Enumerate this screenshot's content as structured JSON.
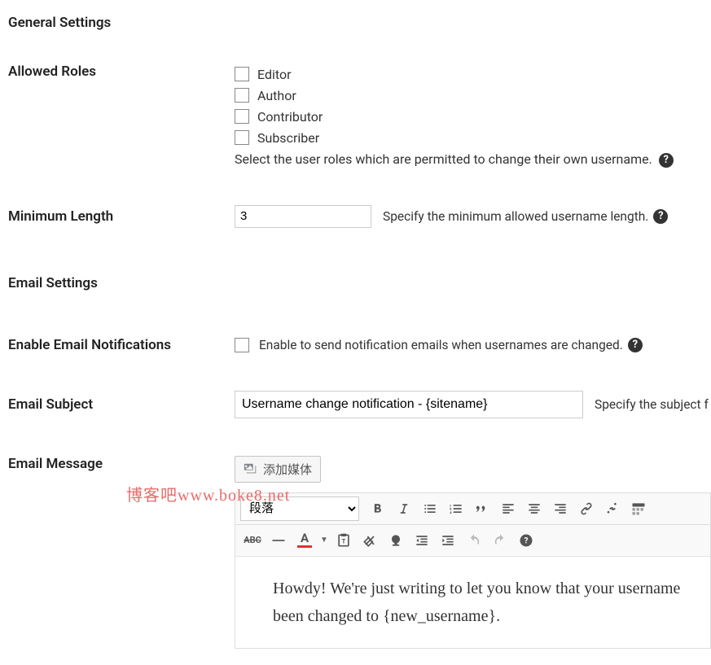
{
  "sections": {
    "general": "General Settings",
    "email": "Email Settings"
  },
  "allowed_roles": {
    "label": "Allowed Roles",
    "options": [
      "Editor",
      "Author",
      "Contributor",
      "Subscriber"
    ],
    "help": "Select the user roles which are permitted to change their own username."
  },
  "min_length": {
    "label": "Minimum Length",
    "value": "3",
    "help": "Specify the minimum allowed username length."
  },
  "enable_notify": {
    "label": "Enable Email Notifications",
    "help": "Enable to send notification emails when usernames are changed."
  },
  "email_subject": {
    "label": "Email Subject",
    "value": "Username change notification - {sitename}",
    "help": "Specify the subject f"
  },
  "email_message": {
    "label": "Email Message",
    "add_media": "添加媒体",
    "format_dropdown": "段落",
    "content": "Howdy! We're just writing to let you know that your username been changed to {new_username}."
  },
  "watermark": "博客吧www.boke8.net",
  "help_symbol": "?"
}
